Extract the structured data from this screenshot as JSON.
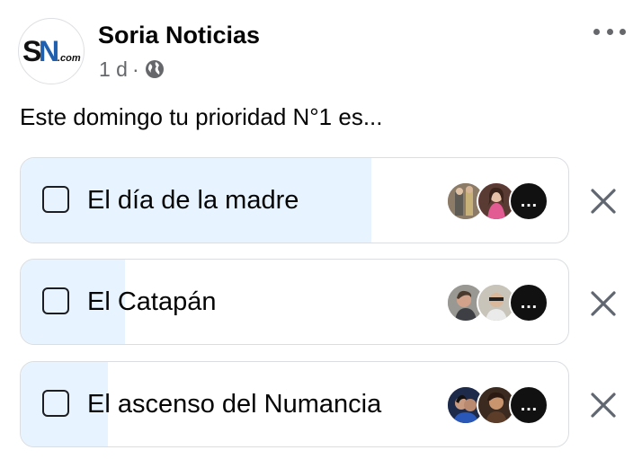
{
  "header": {
    "page_name": "Soria Noticias",
    "logo_text": "SN.com",
    "time": "1 d",
    "separator": "·",
    "audience_icon": "globe-icon",
    "more_icon": "more-horizontal-icon"
  },
  "post": {
    "text": "Este domingo tu prioridad N°1 es..."
  },
  "poll": {
    "options": [
      {
        "label": "El día de la madre",
        "vote_share": 0.64,
        "voters_more": "…",
        "voter_colors": [
          "#7a6a58",
          "#c65a7e"
        ]
      },
      {
        "label": "El Catapán",
        "vote_share": 0.19,
        "voters_more": "…",
        "voter_colors": [
          "#8c8a86",
          "#b9b4aa"
        ]
      },
      {
        "label": "El ascenso del Numancia",
        "vote_share": 0.16,
        "voters_more": "…",
        "voter_colors": [
          "#2d3e66",
          "#6b4a32"
        ]
      }
    ]
  },
  "colors": {
    "fill": "#e7f3ff",
    "border": "#dadde1",
    "secondary_text": "#65676b"
  }
}
